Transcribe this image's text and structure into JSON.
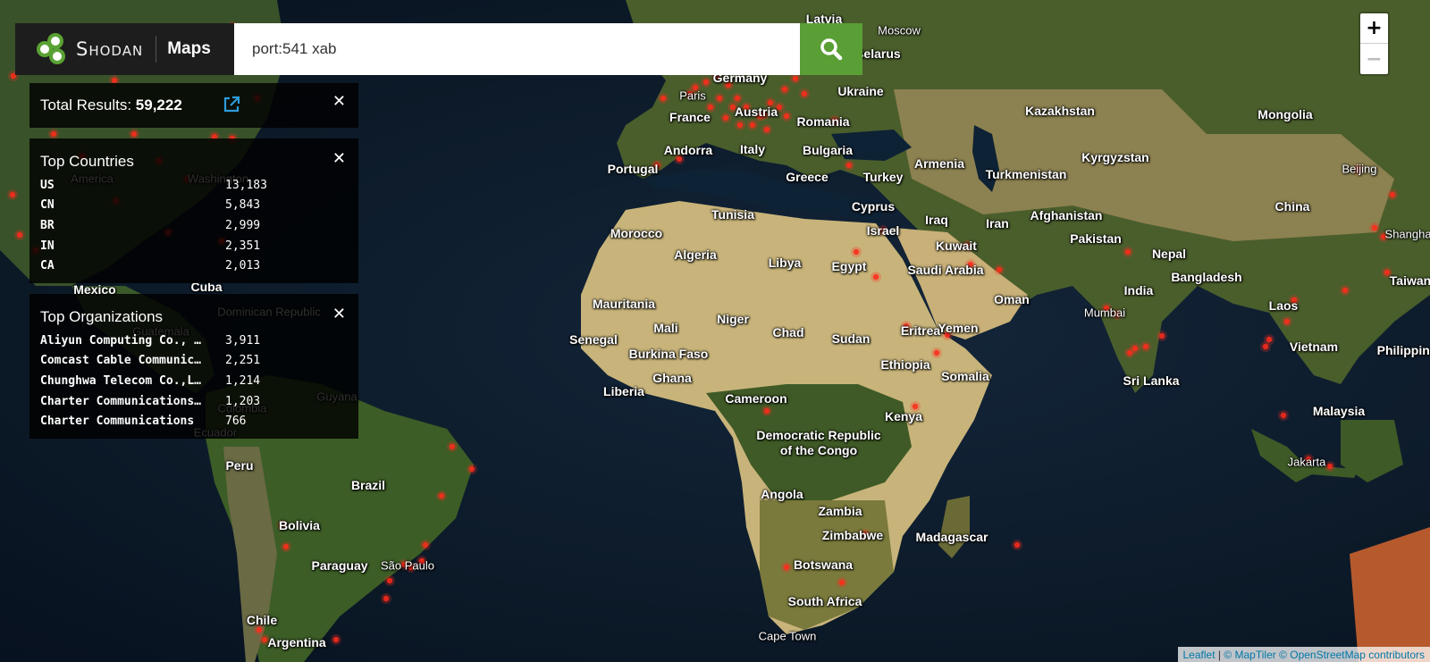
{
  "brand": {
    "name": "Shodan",
    "section": "Maps",
    "colors": {
      "logo_green": "#5aa234",
      "header_bg": "#1d1d1d"
    }
  },
  "search": {
    "query": "port:541 xab",
    "button_icon": "search-icon",
    "button_color": "#5a9e36"
  },
  "total_results": {
    "label": "Total Results:",
    "value": "59,222",
    "export_icon": "external-link-icon",
    "close_icon": "close-icon"
  },
  "top_countries": {
    "title": "Top Countries",
    "rows": [
      {
        "name": "US",
        "count": "13,183"
      },
      {
        "name": "CN",
        "count": "5,843"
      },
      {
        "name": "BR",
        "count": "2,999"
      },
      {
        "name": "IN",
        "count": "2,351"
      },
      {
        "name": "CA",
        "count": "2,013"
      }
    ]
  },
  "top_organizations": {
    "title": "Top Organizations",
    "rows": [
      {
        "name": "Aliyun Computing Co., …",
        "count": "3,911"
      },
      {
        "name": "Comcast Cable Communic…",
        "count": "2,251"
      },
      {
        "name": "Chunghwa Telecom Co.,L…",
        "count": "1,214"
      },
      {
        "name": "Charter Communications…",
        "count": "1,203"
      },
      {
        "name": "Charter Communications",
        "count": "766"
      }
    ]
  },
  "zoom": {
    "in": "+",
    "out": "−"
  },
  "attribution": {
    "leaflet": "Leaflet",
    "maptiler": "© MapTiler",
    "osm": "© OpenStreetMap contributors"
  },
  "map": {
    "marker_color": "#ff2a1a",
    "labels": [
      "Latvia",
      "Moscow",
      "Belarus",
      "Ukraine",
      "Germany",
      "Paris",
      "France",
      "Austria",
      "Romania",
      "Andorra",
      "Italy",
      "Bulgaria",
      "Portugal",
      "Greece",
      "Turkey",
      "Armenia",
      "Kazakhstan",
      "Mongolia",
      "Kyrgyzstan",
      "Turkmenistan",
      "Beijing",
      "Cyprus",
      "Tunisia",
      "Morocco",
      "Israel",
      "Iraq",
      "Iran",
      "Afghanistan",
      "China",
      "Kuwait",
      "Pakistan",
      "Algeria",
      "Libya",
      "Egypt",
      "Saudi Arabia",
      "Nepal",
      "Shanghai",
      "Oman",
      "Bangladesh",
      "Mauritania",
      "India",
      "Taiwan",
      "Mali",
      "Niger",
      "Chad",
      "Sudan",
      "Eritrea",
      "Yemen",
      "Mumbai",
      "Laos",
      "Senegal",
      "Vietnam",
      "Burkina Faso",
      "Philippines",
      "Ghana",
      "Ethiopia",
      "Somalia",
      "Liberia",
      "Sri Lanka",
      "Cameroon",
      "Kenya",
      "Malaysia",
      "Democratic Republic",
      "of the Congo",
      "Jakarta",
      "Angola",
      "Zambia",
      "Zimbabwe",
      "Madagascar",
      "Botswana",
      "South Africa",
      "Cape Town",
      "Mexico",
      "Cuba",
      "Dominican Republic",
      "Guatemala",
      "Colombia",
      "Guyana",
      "Ecuador",
      "Peru",
      "Brazil",
      "Bolivia",
      "Paraguay",
      "São Paulo",
      "Chile",
      "Argentina",
      "America",
      "Washington"
    ]
  }
}
